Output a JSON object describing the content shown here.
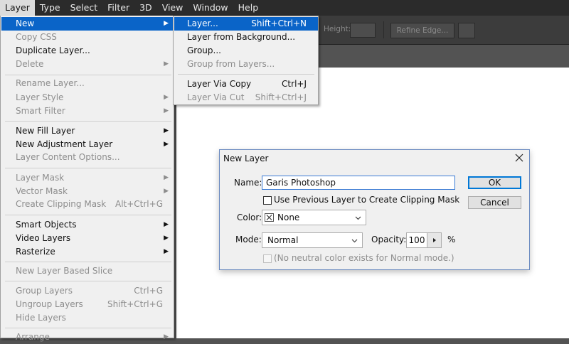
{
  "menubar": {
    "items": [
      "Layer",
      "Type",
      "Select",
      "Filter",
      "3D",
      "View",
      "Window",
      "Help"
    ]
  },
  "optionsbar": {
    "height_label": "Height:",
    "refine_edge": "Refine Edge..."
  },
  "layer_menu": {
    "items": [
      {
        "label": "New",
        "state": "highlighted",
        "submenu": true
      },
      {
        "label": "Copy CSS",
        "state": "disabled"
      },
      {
        "label": "Duplicate Layer...",
        "state": "enabled"
      },
      {
        "label": "Delete",
        "state": "disabled",
        "submenu": true
      },
      {
        "label": "Rename Layer...",
        "state": "disabled"
      },
      {
        "label": "Layer Style",
        "state": "disabled",
        "submenu": true
      },
      {
        "label": "Smart Filter",
        "state": "disabled",
        "submenu": true
      },
      {
        "label": "New Fill Layer",
        "state": "enabled",
        "submenu": true
      },
      {
        "label": "New Adjustment Layer",
        "state": "enabled",
        "submenu": true
      },
      {
        "label": "Layer Content Options...",
        "state": "disabled"
      },
      {
        "label": "Layer Mask",
        "state": "disabled",
        "submenu": true
      },
      {
        "label": "Vector Mask",
        "state": "disabled",
        "submenu": true
      },
      {
        "label": "Create Clipping Mask",
        "state": "disabled",
        "shortcut": "Alt+Ctrl+G"
      },
      {
        "label": "Smart Objects",
        "state": "enabled",
        "submenu": true
      },
      {
        "label": "Video Layers",
        "state": "enabled",
        "submenu": true
      },
      {
        "label": "Rasterize",
        "state": "enabled",
        "submenu": true
      },
      {
        "label": "New Layer Based Slice",
        "state": "disabled"
      },
      {
        "label": "Group Layers",
        "state": "disabled",
        "shortcut": "Ctrl+G"
      },
      {
        "label": "Ungroup Layers",
        "state": "disabled",
        "shortcut": "Shift+Ctrl+G"
      },
      {
        "label": "Hide Layers",
        "state": "disabled"
      },
      {
        "label": "Arrange",
        "state": "disabled",
        "submenu": true
      }
    ]
  },
  "new_submenu": {
    "items": [
      {
        "label": "Layer...",
        "shortcut": "Shift+Ctrl+N",
        "state": "highlighted"
      },
      {
        "label": "Layer from Background...",
        "state": "enabled"
      },
      {
        "label": "Group...",
        "state": "enabled"
      },
      {
        "label": "Group from Layers...",
        "state": "disabled"
      },
      {
        "label": "Layer Via Copy",
        "shortcut": "Ctrl+J",
        "state": "enabled"
      },
      {
        "label": "Layer Via Cut",
        "shortcut": "Shift+Ctrl+J",
        "state": "disabled"
      }
    ]
  },
  "dialog": {
    "title": "New Layer",
    "name_label": "Name:",
    "name_value": "Garis Photoshop",
    "clip_label": "Use Previous Layer to Create Clipping Mask",
    "color_label": "Color:",
    "color_value": "None",
    "mode_label": "Mode:",
    "mode_value": "Normal",
    "opacity_label": "Opacity:",
    "opacity_value": "100",
    "opacity_unit": "%",
    "neutral_label": "(No neutral color exists for Normal mode.)",
    "ok_label": "OK",
    "cancel_label": "Cancel"
  },
  "colors": {
    "highlight": "#0a64c8",
    "menubar_bg": "#2b2b2b",
    "menu_bg": "#f0f0f0",
    "disabled_text": "#8d8d8d"
  }
}
